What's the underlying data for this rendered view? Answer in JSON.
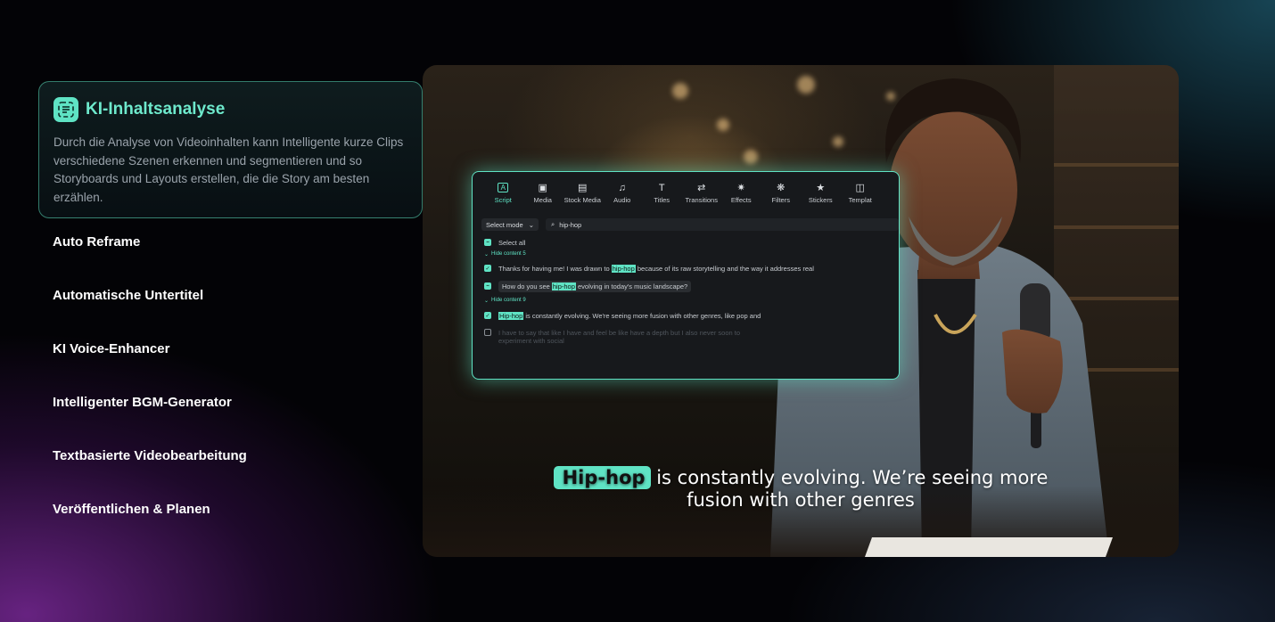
{
  "features": {
    "active": {
      "title": "KI-Inhaltsanalyse",
      "icon": "text-scan-icon",
      "description": "Durch die Analyse von Videoinhalten kann Intelligente kurze Clips verschiedene Szenen erkennen und segmentieren und so Storyboards und Layouts erstellen, die die Story am besten erzählen."
    },
    "items": [
      {
        "label": "Auto Reframe"
      },
      {
        "label": "Automatische Untertitel"
      },
      {
        "label": "KI Voice-Enhancer"
      },
      {
        "label": "Intelligenter BGM-Generator"
      },
      {
        "label": "Textbasierte Videobearbeitung"
      },
      {
        "label": "Veröffentlichen & Planen"
      }
    ]
  },
  "editor": {
    "toolbar": [
      {
        "label": "Script",
        "icon": "script-icon",
        "active": true
      },
      {
        "label": "Media",
        "icon": "media-icon"
      },
      {
        "label": "Stock Media",
        "icon": "stock-media-icon"
      },
      {
        "label": "Audio",
        "icon": "music-note-icon"
      },
      {
        "label": "Titles",
        "icon": "titles-icon"
      },
      {
        "label": "Transitions",
        "icon": "transitions-icon"
      },
      {
        "label": "Effects",
        "icon": "effects-icon"
      },
      {
        "label": "Filters",
        "icon": "filters-icon"
      },
      {
        "label": "Stickers",
        "icon": "stickers-icon"
      },
      {
        "label": "Templat",
        "icon": "templates-icon"
      }
    ],
    "mode_select": "Select mode",
    "search_value": "hip-hop",
    "select_all": "Select all",
    "hide_content_1": "Hide content 5",
    "line1_pre": "Thanks for having me! I was drawn to ",
    "line1_hl": "hip-hop",
    "line1_post": " because of its raw storytelling and the way it addresses real",
    "line2_pre": "How do you see ",
    "line2_hl": "hip-hop",
    "line2_post": " evolving in today's music landscape?",
    "hide_content_2": "Hide content 9",
    "line3_hl": "Hip-hop",
    "line3_post": " is constantly evolving. We're seeing more fusion with other genres, like pop and",
    "line4": "I have to say that like I have and feel be like have a depth but I also never soon to",
    "line5": "experiment with social"
  },
  "subtitle": {
    "highlight": "Hip-hop",
    "line1_rest": "is constantly evolving. We’re seeing more",
    "line2": "fusion with other genres"
  },
  "colors": {
    "accent": "#5fe3c4",
    "title_accent": "#6ee9cc"
  }
}
